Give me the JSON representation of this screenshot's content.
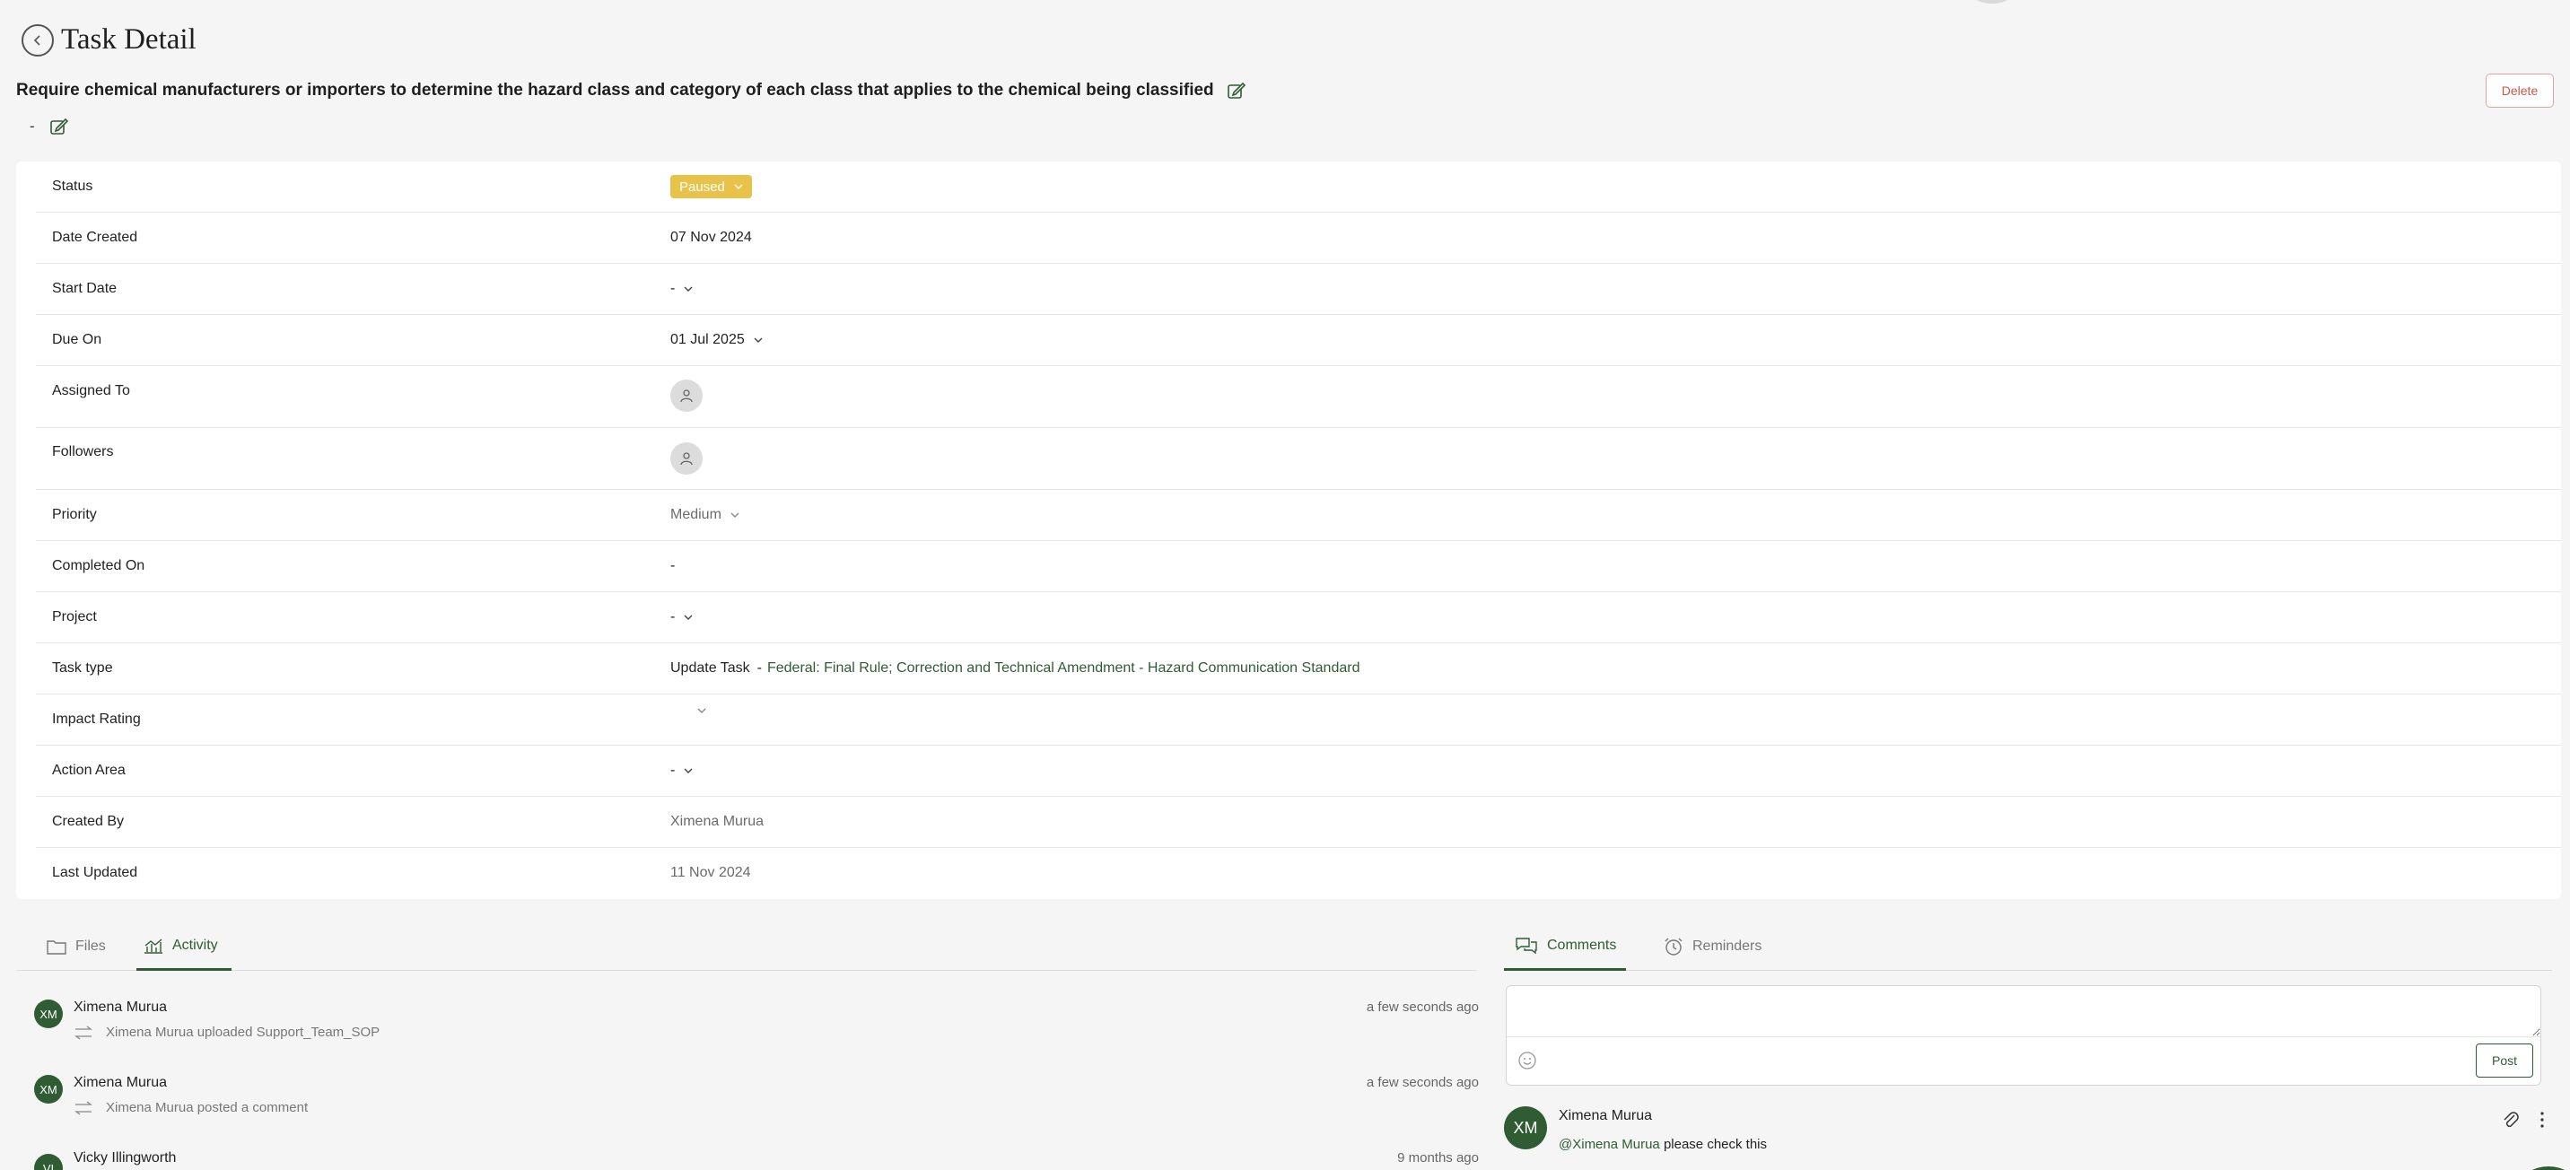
{
  "header": {
    "title": "Task Detail"
  },
  "task": {
    "title": "Require chemical manufacturers or importers to determine the hazard class and category of each class that applies to the chemical being classified",
    "description": "-",
    "delete_label": "Delete"
  },
  "details": {
    "status": {
      "label": "Status",
      "value": "Paused"
    },
    "date_created": {
      "label": "Date Created",
      "value": "07 Nov 2024"
    },
    "start_date": {
      "label": "Start Date",
      "value": "-"
    },
    "due_on": {
      "label": "Due On",
      "value": "01 Jul 2025"
    },
    "assigned_to": {
      "label": "Assigned To"
    },
    "followers": {
      "label": "Followers"
    },
    "priority": {
      "label": "Priority",
      "value": "Medium"
    },
    "completed_on": {
      "label": "Completed On",
      "value": "-"
    },
    "project": {
      "label": "Project",
      "value": "-"
    },
    "task_type": {
      "label": "Task type",
      "value": "Update Task",
      "separator": "-",
      "link": "Federal: Final Rule; Correction and Technical Amendment - Hazard Communication Standard"
    },
    "impact_rating": {
      "label": "Impact Rating"
    },
    "action_area": {
      "label": "Action Area",
      "value": "-"
    },
    "created_by": {
      "label": "Created By",
      "value": "Ximena Murua"
    },
    "last_updated": {
      "label": "Last Updated",
      "value": "11 Nov 2024"
    }
  },
  "left_tabs": {
    "files": "Files",
    "activity": "Activity"
  },
  "activity": [
    {
      "initials": "XM",
      "name": "Ximena Murua",
      "desc": "Ximena Murua uploaded Support_Team_SOP",
      "time": "a few seconds ago"
    },
    {
      "initials": "XM",
      "name": "Ximena Murua",
      "desc": "Ximena Murua posted a comment",
      "time": "a few seconds ago"
    },
    {
      "initials": "VI",
      "name": "Vicky Illingworth",
      "time": "9 months ago"
    }
  ],
  "right_tabs": {
    "comments": "Comments",
    "reminders": "Reminders"
  },
  "comment_box": {
    "post_label": "Post"
  },
  "comment": {
    "initials": "XM",
    "author": "Ximena Murua",
    "mention": "@Ximena Murua",
    "text": " please check this"
  },
  "colors": {
    "accent": "#2f5c33",
    "status_paused": "#e9c24a",
    "delete": "#c65a4a"
  }
}
